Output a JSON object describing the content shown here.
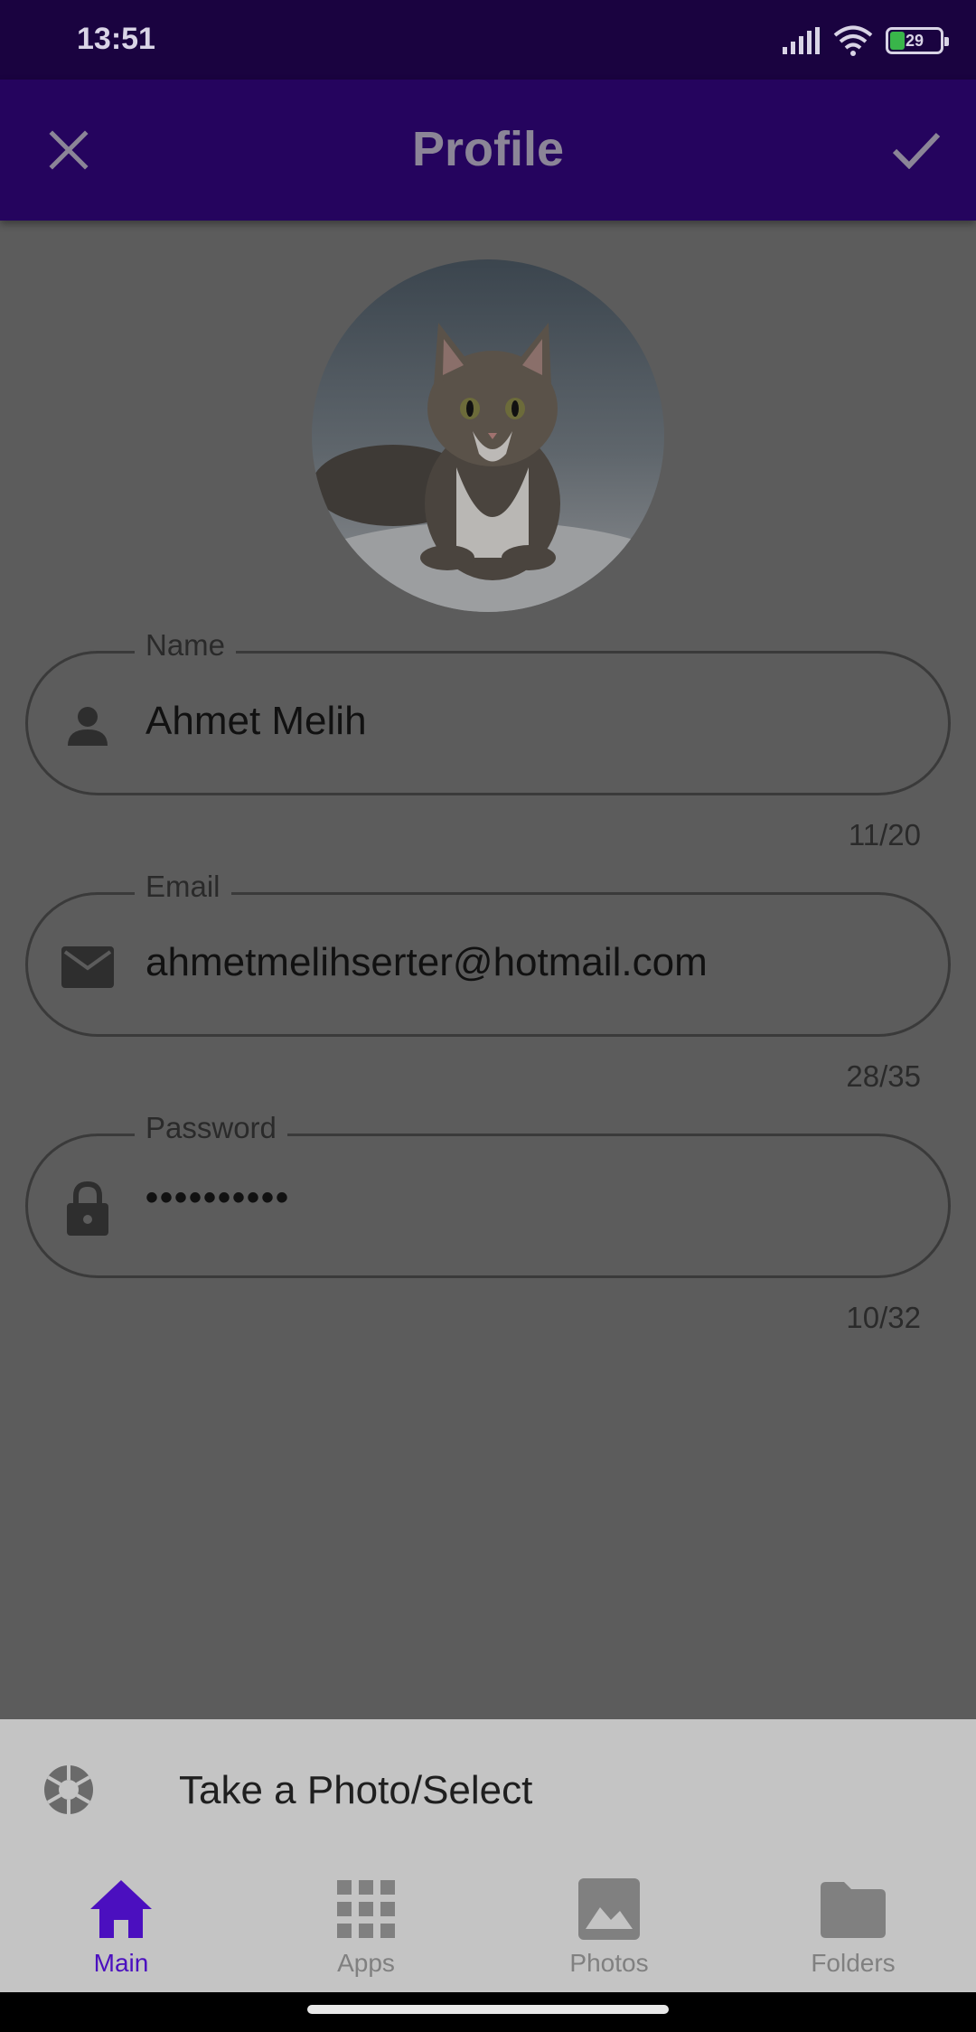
{
  "status_bar": {
    "time": "13:51",
    "battery_level": "29"
  },
  "app_bar": {
    "title": "Profile",
    "close_icon": "close-icon",
    "confirm_icon": "check-icon"
  },
  "avatar": {
    "description_icon": "cat-photo"
  },
  "fields": {
    "name": {
      "label": "Name",
      "value": "Ahmet Melih",
      "counter": "11/20",
      "icon": "person-icon"
    },
    "email": {
      "label": "Email",
      "value": "ahmetmelihserter@hotmail.com",
      "counter": "28/35",
      "icon": "mail-icon"
    },
    "password": {
      "label": "Password",
      "value": "••••••••••",
      "counter": "10/32",
      "icon": "lock-icon"
    }
  },
  "sheet": {
    "action_label": "Take a Photo/Select",
    "action_icon": "camera-shutter-icon"
  },
  "bottom_nav": {
    "items": [
      {
        "label": "Main",
        "icon": "home-icon",
        "active": true
      },
      {
        "label": "Apps",
        "icon": "apps-grid-icon",
        "active": false
      },
      {
        "label": "Photos",
        "icon": "image-icon",
        "active": false
      },
      {
        "label": "Folders",
        "icon": "folder-icon",
        "active": false
      }
    ]
  },
  "colors": {
    "accent": "#4b0fbf",
    "app_bar": "#25045e",
    "status_bar": "#1a0340",
    "scrim": "#5c5c5c",
    "sheet": "#c4c4c4"
  }
}
